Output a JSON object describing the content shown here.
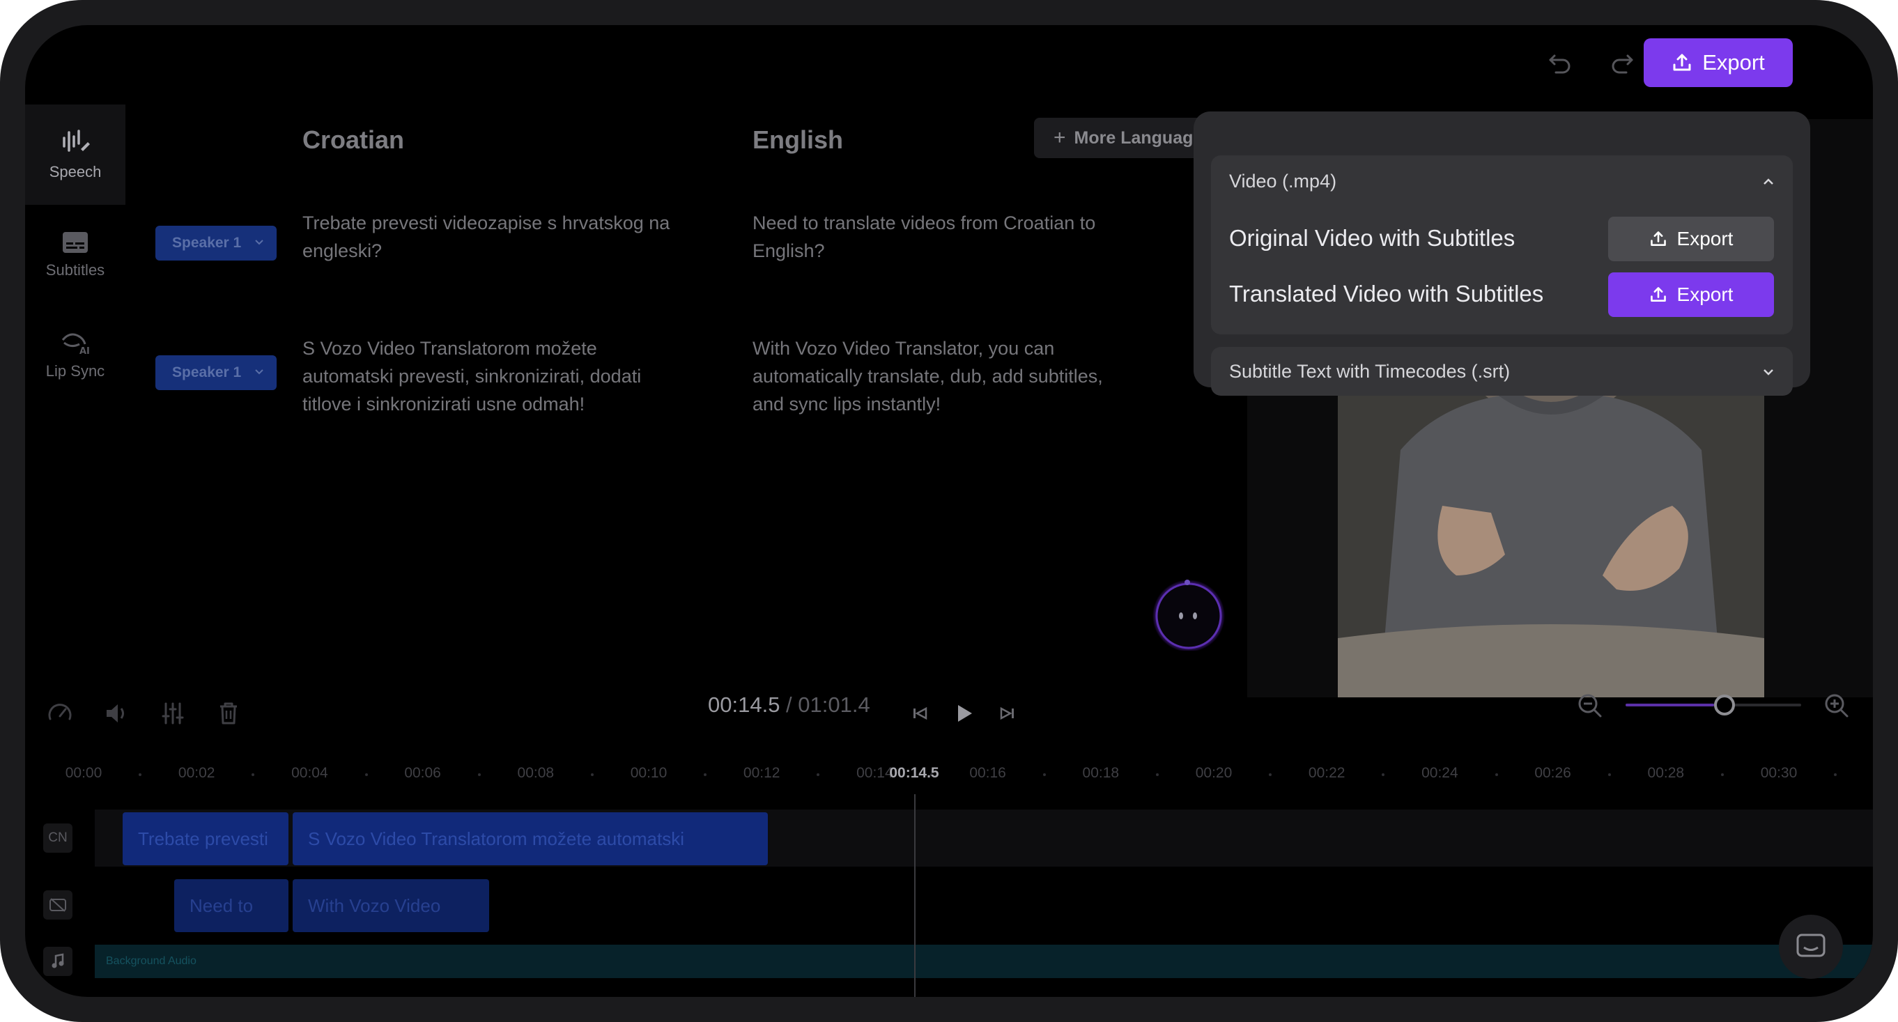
{
  "toolbar": {
    "undo_icon": "undo-icon",
    "redo_icon": "redo-icon",
    "export_label": "Export",
    "accent_color": "#7c3aed"
  },
  "sidebar": {
    "items": [
      {
        "label": "Speech",
        "icon": "waveform-icon",
        "active": true
      },
      {
        "label": "Subtitles",
        "icon": "subtitles-icon",
        "active": false
      },
      {
        "label": "Lip Sync",
        "icon": "lip-sync-icon",
        "active": false
      }
    ]
  },
  "languages": {
    "source": "Croatian",
    "target": "English",
    "more_label": "More Languag"
  },
  "segments": [
    {
      "speaker": "Speaker 1",
      "source": "Trebate prevesti videozapise s hrvatskog na engleski?",
      "target": "Need to translate videos from Croatian to English?"
    },
    {
      "speaker": "Speaker 1",
      "source": "S Vozo Video Translatorom možete automatski prevesti, sinkronizirati, dodati titlove i sinkronizirati usne odmah!",
      "target": "With Vozo Video Translator, you can automatically translate, dub, add subtitles, and sync lips instantly!"
    }
  ],
  "export_menu": {
    "video_section": "Video (.mp4)",
    "options": [
      {
        "label": "Original Video with Subtitles",
        "button": "Export",
        "style": "grey"
      },
      {
        "label": "Translated Video with Subtitles",
        "button": "Export",
        "style": "purple"
      }
    ],
    "srt_section": "Subtitle Text with Timecodes (.srt)"
  },
  "player": {
    "current_time": "00:14.5",
    "separator": " / ",
    "total_time": "01:01.4",
    "zoom_level": 0.5
  },
  "timeline": {
    "ticks": [
      "00:00",
      "00:02",
      "00:04",
      "00:06",
      "00:08",
      "00:10",
      "00:12",
      "00:14",
      "00:16",
      "00:18",
      "00:20",
      "00:22",
      "00:24",
      "00:26",
      "00:28",
      "00:30"
    ],
    "playhead_label": "00:14.5",
    "tracks": {
      "source_badge": "CN",
      "source_clips": [
        "Trebate prevesti",
        "S Vozo Video Translatorom možete automatski"
      ],
      "target_clips": [
        "Need to",
        "With Vozo Video"
      ],
      "audio_label": "Background Audio"
    }
  }
}
